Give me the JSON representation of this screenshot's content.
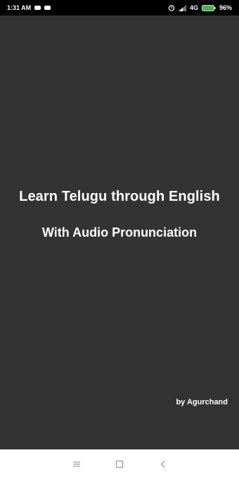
{
  "status_bar": {
    "time": "1:31 AM",
    "network": "4G",
    "battery": "96%"
  },
  "splash": {
    "title": "Learn Telugu through English",
    "subtitle": "With Audio Pronunciation",
    "credit": "by Agurchand"
  },
  "icons": {
    "notification_1": "notification-icon",
    "notification_2": "notification-icon",
    "alarm": "alarm-icon",
    "signal": "signal-icon",
    "battery": "battery-icon",
    "nav_menu": "menu-icon",
    "nav_home": "home-square-icon",
    "nav_back": "back-chevron-icon"
  },
  "colors": {
    "status_bar": "#000000",
    "screen_background": "#333333",
    "text": "#ffffff",
    "nav_bar": "#ffffff",
    "nav_icon": "#9a9a9a",
    "battery_fill": "#4caf50"
  }
}
